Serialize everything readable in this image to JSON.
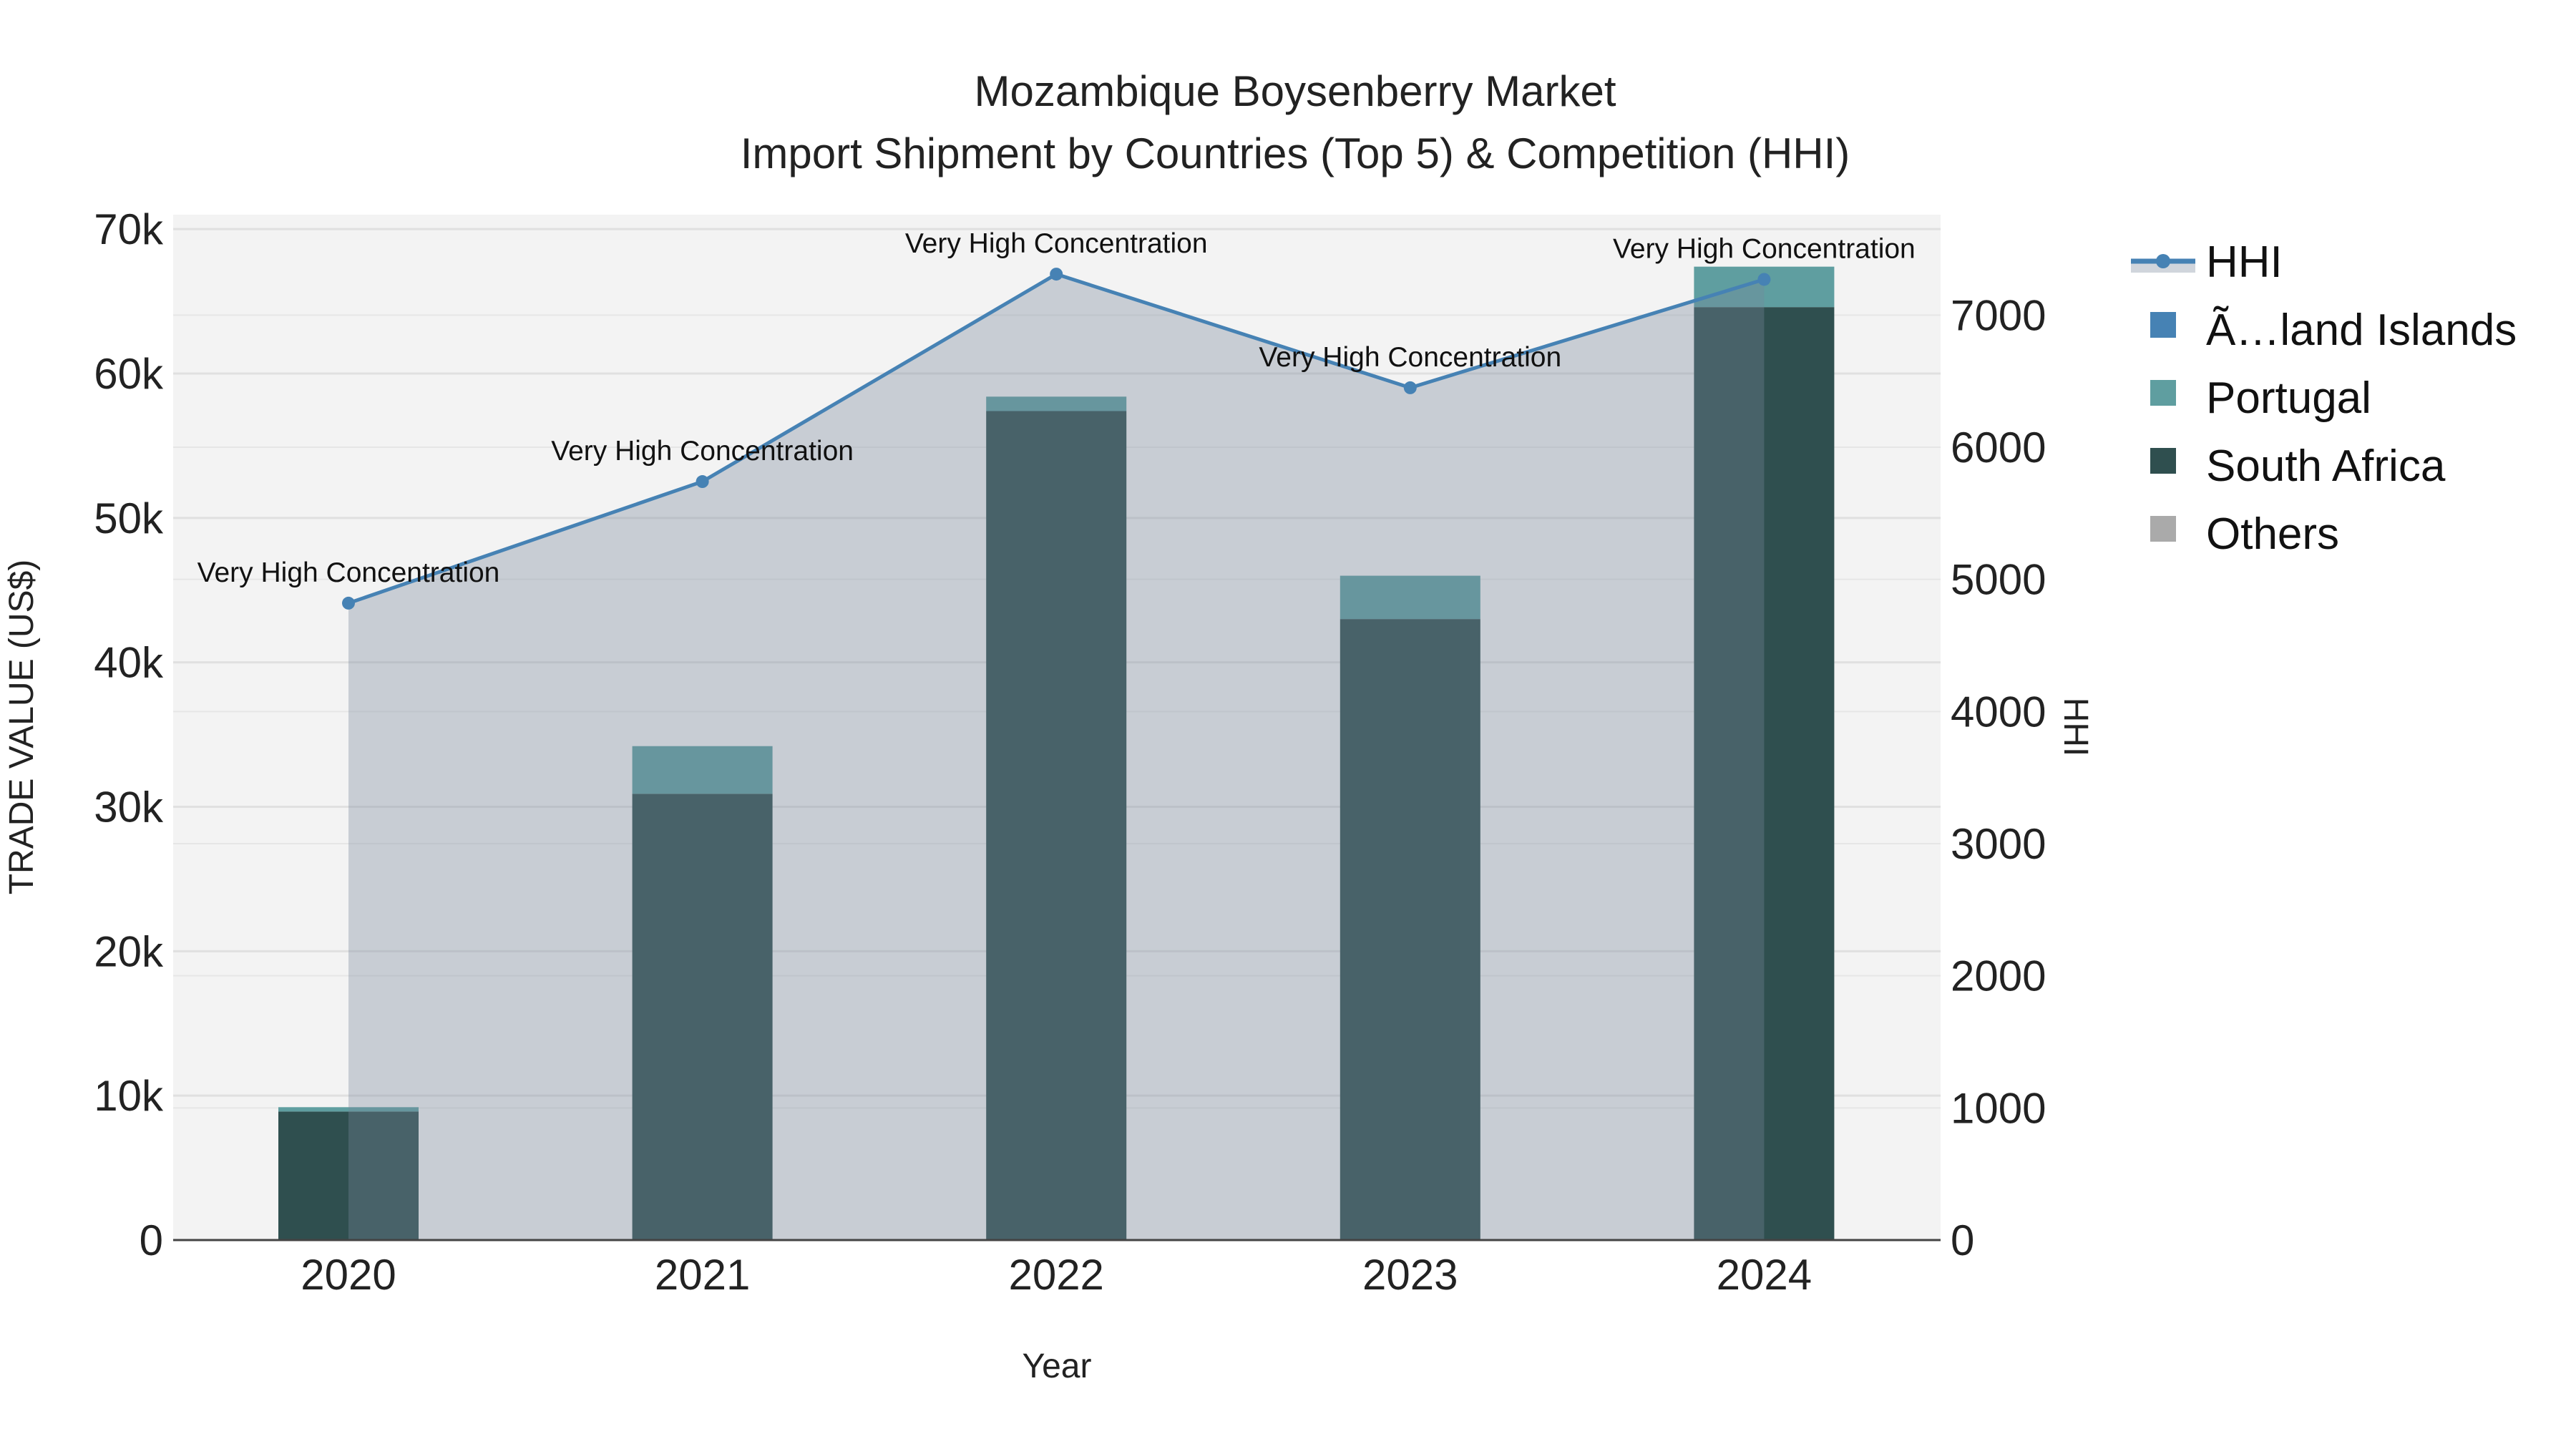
{
  "chart_data": {
    "type": "bar",
    "title": "Mozambique Boysenberry Market",
    "subtitle": "Import Shipment by Countries (Top 5) & Competition (HHI)",
    "xlabel": "Year",
    "ylabel": "TRADE VALUE (US$)",
    "y2label": "HHI",
    "categories": [
      "2020",
      "2021",
      "2022",
      "2023",
      "2024"
    ],
    "ylim": [
      0,
      71000
    ],
    "y2lim": [
      0,
      7760
    ],
    "yticks": [
      {
        "v": 0,
        "label": "0"
      },
      {
        "v": 10000,
        "label": "10k"
      },
      {
        "v": 20000,
        "label": "20k"
      },
      {
        "v": 30000,
        "label": "30k"
      },
      {
        "v": 40000,
        "label": "40k"
      },
      {
        "v": 50000,
        "label": "50k"
      },
      {
        "v": 60000,
        "label": "60k"
      },
      {
        "v": 70000,
        "label": "70k"
      }
    ],
    "y2ticks": [
      {
        "v": 0,
        "label": "0"
      },
      {
        "v": 1000,
        "label": "1000"
      },
      {
        "v": 2000,
        "label": "2000"
      },
      {
        "v": 3000,
        "label": "3000"
      },
      {
        "v": 4000,
        "label": "4000"
      },
      {
        "v": 5000,
        "label": "5000"
      },
      {
        "v": 6000,
        "label": "6000"
      },
      {
        "v": 7000,
        "label": "7000"
      }
    ],
    "series": [
      {
        "name": "Ã…land Islands",
        "color": "#4682b4",
        "values": [
          0,
          0,
          0,
          0,
          0
        ]
      },
      {
        "name": "Portugal",
        "color": "#5f9ea0",
        "values": [
          300,
          3300,
          1000,
          3000,
          2800
        ]
      },
      {
        "name": "South Africa",
        "color": "#2f4f4f",
        "values": [
          8900,
          30900,
          57400,
          43000,
          64600
        ]
      },
      {
        "name": "Others",
        "color": "#aaaaaa",
        "values": [
          0,
          0,
          0,
          0,
          0
        ]
      }
    ],
    "stack_order": [
      "South Africa",
      "Portugal",
      "Ã…land Islands",
      "Others"
    ],
    "hhi": {
      "name": "HHI",
      "color": "#4682b4",
      "values": [
        4820,
        5740,
        7310,
        6450,
        7270
      ],
      "annotations": [
        "Very High Concentration",
        "Very High Concentration",
        "Very High Concentration",
        "Very High Concentration",
        "Very High Concentration"
      ]
    },
    "legend": [
      "HHI",
      "Ã…land Islands",
      "Portugal",
      "South Africa",
      "Others"
    ],
    "legend_position": "right",
    "grid": true
  }
}
